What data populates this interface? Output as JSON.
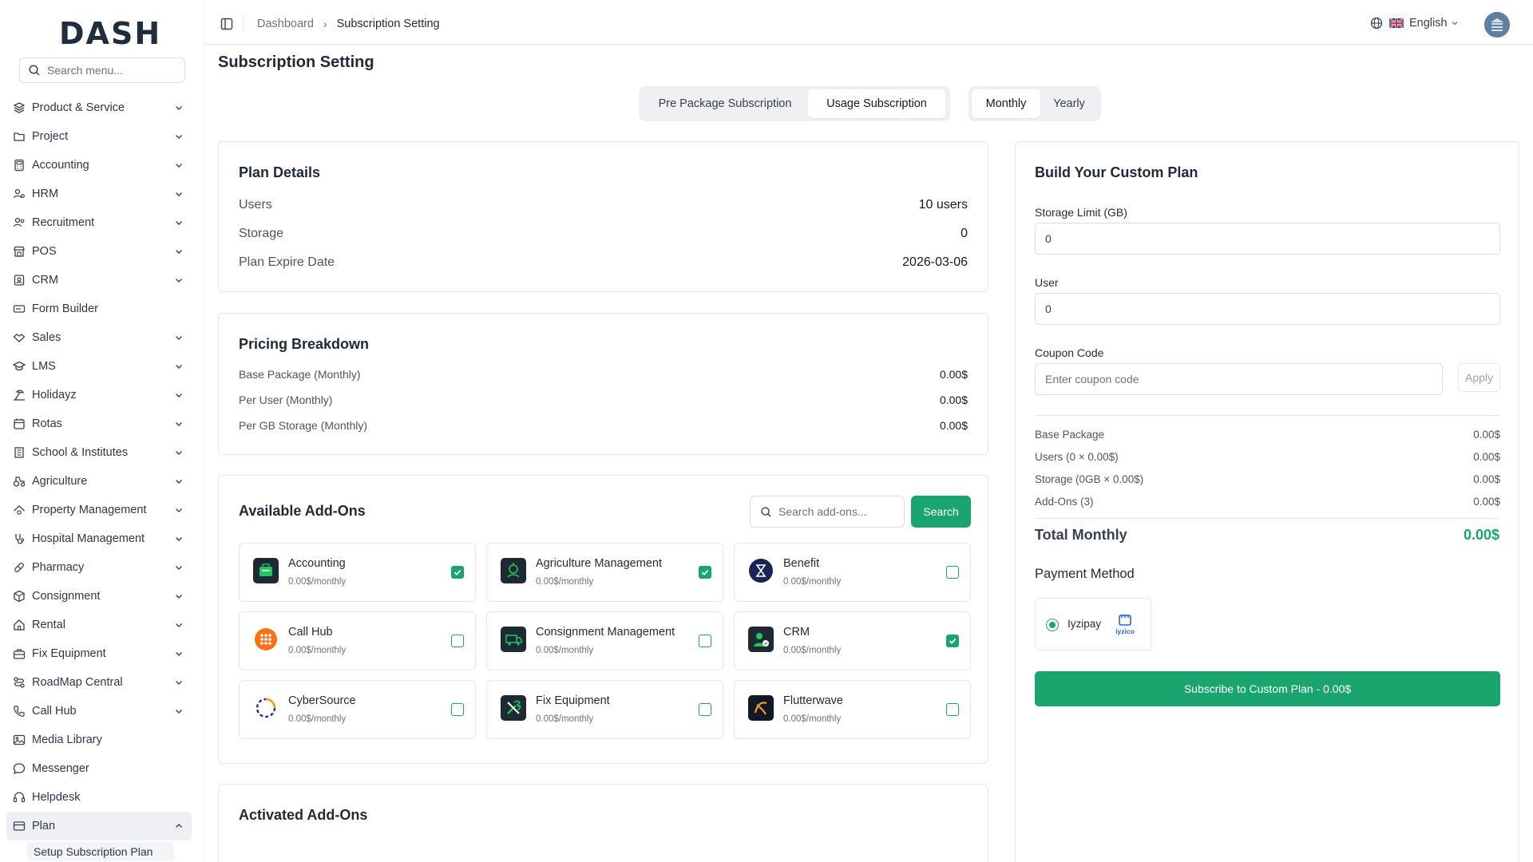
{
  "brand": {
    "logo_text": "DASH"
  },
  "sidebar": {
    "search_placeholder": "Search menu...",
    "items": [
      {
        "label": "Product & Service",
        "icon": "layers-icon",
        "chevron": true
      },
      {
        "label": "Project",
        "icon": "folder-icon",
        "chevron": true
      },
      {
        "label": "Accounting",
        "icon": "calculator-icon",
        "chevron": true
      },
      {
        "label": "HRM",
        "icon": "users-cog-icon",
        "chevron": true
      },
      {
        "label": "Recruitment",
        "icon": "user-search-icon",
        "chevron": true
      },
      {
        "label": "POS",
        "icon": "store-icon",
        "chevron": true
      },
      {
        "label": "CRM",
        "icon": "contact-icon",
        "chevron": true
      },
      {
        "label": "Form Builder",
        "icon": "form-icon",
        "chevron": false
      },
      {
        "label": "Sales",
        "icon": "handshake-icon",
        "chevron": true
      },
      {
        "label": "LMS",
        "icon": "graduation-cap-icon",
        "chevron": true
      },
      {
        "label": "Holidayz",
        "icon": "beach-icon",
        "chevron": true
      },
      {
        "label": "Rotas",
        "icon": "calendar-clock-icon",
        "chevron": true
      },
      {
        "label": "School & Institutes",
        "icon": "school-icon",
        "chevron": true
      },
      {
        "label": "Agriculture",
        "icon": "tractor-icon",
        "chevron": true
      },
      {
        "label": "Property Management",
        "icon": "property-icon",
        "chevron": true
      },
      {
        "label": "Hospital Management",
        "icon": "stethoscope-icon",
        "chevron": true
      },
      {
        "label": "Pharmacy",
        "icon": "pill-icon",
        "chevron": true
      },
      {
        "label": "Consignment",
        "icon": "package-icon",
        "chevron": true
      },
      {
        "label": "Rental",
        "icon": "home-icon",
        "chevron": true
      },
      {
        "label": "Fix Equipment",
        "icon": "toolbox-icon",
        "chevron": true
      },
      {
        "label": "RoadMap Central",
        "icon": "roadmap-icon",
        "chevron": true
      },
      {
        "label": "Call Hub",
        "icon": "phone-icon",
        "chevron": true
      },
      {
        "label": "Media Library",
        "icon": "image-icon",
        "chevron": false
      },
      {
        "label": "Messenger",
        "icon": "message-icon",
        "chevron": false
      },
      {
        "label": "Helpdesk",
        "icon": "headset-icon",
        "chevron": false
      },
      {
        "label": "Plan",
        "icon": "credit-card-icon",
        "chevron": true,
        "expanded": true
      }
    ],
    "subitem": "Setup Subscription Plan"
  },
  "header": {
    "breadcrumb": [
      "Dashboard",
      "Subscription Setting"
    ],
    "language": "English"
  },
  "page": {
    "title": "Subscription Setting",
    "type_tabs": [
      "Pre Package Subscription",
      "Usage Subscription"
    ],
    "type_selected": "Usage Subscription",
    "period_tabs": [
      "Monthly",
      "Yearly"
    ],
    "period_selected": "Monthly"
  },
  "plan_details": {
    "title": "Plan Details",
    "rows": [
      {
        "label": "Users",
        "value": "10 users"
      },
      {
        "label": "Storage",
        "value": "0"
      },
      {
        "label": "Plan Expire Date",
        "value": "2026-03-06"
      }
    ]
  },
  "pricing": {
    "title": "Pricing Breakdown",
    "rows": [
      {
        "label": "Base Package (Monthly)",
        "value": "0.00$"
      },
      {
        "label": "Per User (Monthly)",
        "value": "0.00$"
      },
      {
        "label": "Per GB Storage (Monthly)",
        "value": "0.00$"
      }
    ]
  },
  "addons": {
    "title": "Available Add-Ons",
    "search_placeholder": "Search add-ons...",
    "search_button": "Search",
    "items": [
      {
        "name": "Accounting",
        "price": "0.00$/monthly",
        "checked": true,
        "icon": "accounting-addon-icon"
      },
      {
        "name": "Agriculture Management",
        "price": "0.00$/monthly",
        "checked": true,
        "icon": "agriculture-addon-icon"
      },
      {
        "name": "Benefit",
        "price": "0.00$/monthly",
        "checked": false,
        "icon": "benefit-addon-icon"
      },
      {
        "name": "Call Hub",
        "price": "0.00$/monthly",
        "checked": false,
        "icon": "callhub-addon-icon"
      },
      {
        "name": "Consignment Management",
        "price": "0.00$/monthly",
        "checked": false,
        "icon": "consignment-addon-icon"
      },
      {
        "name": "CRM",
        "price": "0.00$/monthly",
        "checked": true,
        "icon": "crm-addon-icon"
      },
      {
        "name": "CyberSource",
        "price": "0.00$/monthly",
        "checked": false,
        "icon": "cybersource-addon-icon"
      },
      {
        "name": "Fix Equipment",
        "price": "0.00$/monthly",
        "checked": false,
        "icon": "fix-equipment-addon-icon"
      },
      {
        "name": "Flutterwave",
        "price": "0.00$/monthly",
        "checked": false,
        "icon": "flutterwave-addon-icon"
      }
    ]
  },
  "activated": {
    "title": "Activated Add-Ons"
  },
  "custom_plan": {
    "title": "Build Your Custom Plan",
    "storage_label": "Storage Limit (GB)",
    "storage_value": "0",
    "user_label": "User",
    "user_value": "0",
    "coupon_label": "Coupon Code",
    "coupon_placeholder": "Enter coupon code",
    "apply_label": "Apply",
    "summary": [
      {
        "label": "Base Package",
        "value": "0.00$"
      },
      {
        "label": "Users (0 × 0.00$)",
        "value": "0.00$"
      },
      {
        "label": "Storage (0GB × 0.00$)",
        "value": "0.00$"
      },
      {
        "label": "Add-Ons (3)",
        "value": "0.00$"
      }
    ],
    "total_label": "Total Monthly",
    "total_value": "0.00$",
    "payment_title": "Payment Method",
    "payment_option": "Iyzipay",
    "payment_logo_text": "iyzico",
    "subscribe_label": "Subscribe to Custom Plan - 0.00$"
  },
  "colors": {
    "accent": "#1aa56f",
    "text": "#1f2937",
    "muted": "#6b7280",
    "border": "#e5e7eb"
  }
}
